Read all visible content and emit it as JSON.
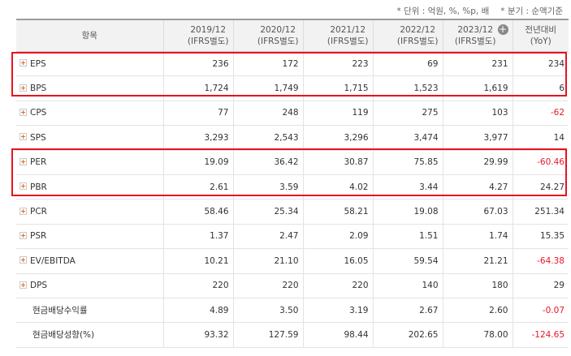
{
  "notes": {
    "unit": "* 단위 : 억원, %, %p, 배",
    "quarter": "* 분기 : 순액기준"
  },
  "header": {
    "item": "항목",
    "years": [
      {
        "year": "2019/12",
        "basis": "(IFRS별도)"
      },
      {
        "year": "2020/12",
        "basis": "(IFRS별도)"
      },
      {
        "year": "2021/12",
        "basis": "(IFRS별도)"
      },
      {
        "year": "2022/12",
        "basis": "(IFRS별도)"
      },
      {
        "year": "2023/12",
        "basis": "(IFRS별도)"
      }
    ],
    "yoy_top": "전년대비",
    "yoy_bottom": "(YoY)"
  },
  "rows": [
    {
      "label": "EPS",
      "values": [
        "236",
        "172",
        "223",
        "69",
        "231"
      ],
      "yoy": "234",
      "expandable": true
    },
    {
      "label": "BPS",
      "values": [
        "1,724",
        "1,749",
        "1,715",
        "1,523",
        "1,619"
      ],
      "yoy": "6",
      "expandable": true
    },
    {
      "label": "CPS",
      "values": [
        "77",
        "248",
        "119",
        "275",
        "103"
      ],
      "yoy": "-62",
      "expandable": true
    },
    {
      "label": "SPS",
      "values": [
        "3,293",
        "2,543",
        "3,296",
        "3,474",
        "3,977"
      ],
      "yoy": "14",
      "expandable": true
    },
    {
      "label": "PER",
      "values": [
        "19.09",
        "36.42",
        "30.87",
        "75.85",
        "29.99"
      ],
      "yoy": "-60.46",
      "expandable": true
    },
    {
      "label": "PBR",
      "values": [
        "2.61",
        "3.59",
        "4.02",
        "3.44",
        "4.27"
      ],
      "yoy": "24.27",
      "expandable": true
    },
    {
      "label": "PCR",
      "values": [
        "58.46",
        "25.34",
        "58.21",
        "19.08",
        "67.03"
      ],
      "yoy": "251.34",
      "expandable": true
    },
    {
      "label": "PSR",
      "values": [
        "1.37",
        "2.47",
        "2.09",
        "1.51",
        "1.74"
      ],
      "yoy": "15.35",
      "expandable": true
    },
    {
      "label": "EV/EBITDA",
      "values": [
        "10.21",
        "21.10",
        "16.05",
        "59.54",
        "21.21"
      ],
      "yoy": "-64.38",
      "expandable": true
    },
    {
      "label": "DPS",
      "values": [
        "220",
        "220",
        "220",
        "140",
        "180"
      ],
      "yoy": "29",
      "expandable": true
    },
    {
      "label": "현금배당수익률",
      "values": [
        "4.89",
        "3.50",
        "3.19",
        "2.67",
        "2.60"
      ],
      "yoy": "-0.07",
      "expandable": false
    },
    {
      "label": "현금배당성향(%)",
      "values": [
        "93.32",
        "127.59",
        "98.44",
        "202.65",
        "78.00"
      ],
      "yoy": "-124.65",
      "expandable": false
    }
  ],
  "colors": {
    "highlight": "#e8121f",
    "negative": "#e8172a",
    "expand_plus": "#e66c1a",
    "header_bg": "#f2f2f2"
  }
}
